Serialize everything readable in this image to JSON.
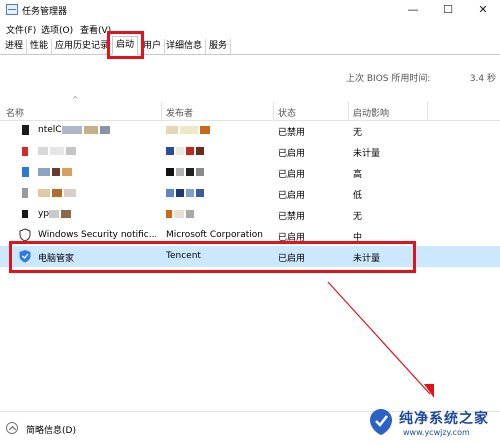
{
  "window": {
    "title": "任务管理器",
    "icon": "task-manager-icon"
  },
  "controls": {
    "minimize": "—",
    "maximize": "☐",
    "close": "✕"
  },
  "menu": [
    "文件(F)",
    "选项(O)",
    "查看(V)"
  ],
  "tabs": [
    "进程",
    "性能",
    "应用历史记录",
    "启动",
    "用户",
    "详细信息",
    "服务"
  ],
  "bios": {
    "label": "上次 BIOS 所用时间:",
    "value": "3.4 秒"
  },
  "columns": {
    "name": "名称",
    "publisher": "发布者",
    "status": "状态",
    "impact": "启动影响"
  },
  "rows": [
    {
      "name": "ntelC",
      "publisher": "",
      "status": "已禁用",
      "impact": "无"
    },
    {
      "name": "",
      "publisher": "",
      "status": "已启用",
      "impact": "未计量"
    },
    {
      "name": "",
      "publisher": "",
      "status": "已启用",
      "impact": "高"
    },
    {
      "name": "",
      "publisher": "",
      "status": "已启用",
      "impact": "低"
    },
    {
      "name": "yp",
      "publisher": "",
      "status": "已禁用",
      "impact": "无"
    },
    {
      "name": "Windows Security notific...",
      "publisher": "Microsoft Corporation",
      "status": "已启用",
      "impact": "中"
    },
    {
      "name": "电脑管家",
      "publisher": "Tencent",
      "status": "已启用",
      "impact": "未计量"
    }
  ],
  "footer": {
    "less_details": "简略信息(D)"
  },
  "watermark": {
    "name": "纯净系统之家",
    "url": "www.ycwjzy.com"
  },
  "colors": {
    "highlight": "#e0141a",
    "selection": "#cce8ff",
    "arrow": "#e0141a"
  }
}
